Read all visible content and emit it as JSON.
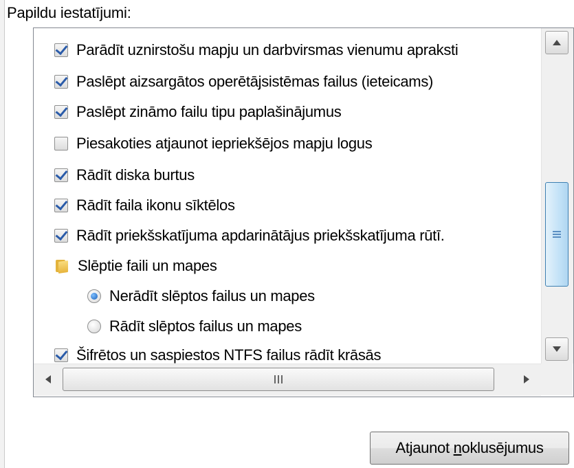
{
  "section_label": "Papildu iestatījumi:",
  "tree_items": [
    {
      "type": "checkbox",
      "checked": true,
      "label": "Parādīt uznirstošu mapju un darbvirsmas vienumu apraksti"
    },
    {
      "type": "checkbox",
      "checked": true,
      "label": "Paslēpt aizsargātos operētājsistēmas failus (ieteicams)"
    },
    {
      "type": "checkbox",
      "checked": true,
      "label": "Paslēpt zināmo failu tipu paplašinājumus"
    },
    {
      "type": "checkbox",
      "checked": false,
      "label": "Piesakoties atjaunot iepriekšējos mapju logus"
    },
    {
      "type": "checkbox",
      "checked": true,
      "label": "Rādīt diska burtus"
    },
    {
      "type": "checkbox",
      "checked": true,
      "label": "Rādīt faila ikonu sīktēlos"
    },
    {
      "type": "checkbox",
      "checked": true,
      "label": "Rādīt priekšskatījuma apdarinātājus priekšskatījuma rūtī."
    },
    {
      "type": "folder",
      "icon": "folder-icon",
      "label": "Slēptie faili un mapes"
    },
    {
      "type": "radio",
      "checked": true,
      "label": "Nerādīt slēptos failus un mapes"
    },
    {
      "type": "radio",
      "checked": false,
      "label": "Rādīt slēptos failus un mapes"
    },
    {
      "type": "checkbox",
      "checked": true,
      "label": "Šifrētos un saspiestos NTFS failus rādīt krāsās"
    }
  ],
  "button": {
    "prefix": "Atjaunot ",
    "mnemonic": "n",
    "suffix": "oklusējumus"
  }
}
